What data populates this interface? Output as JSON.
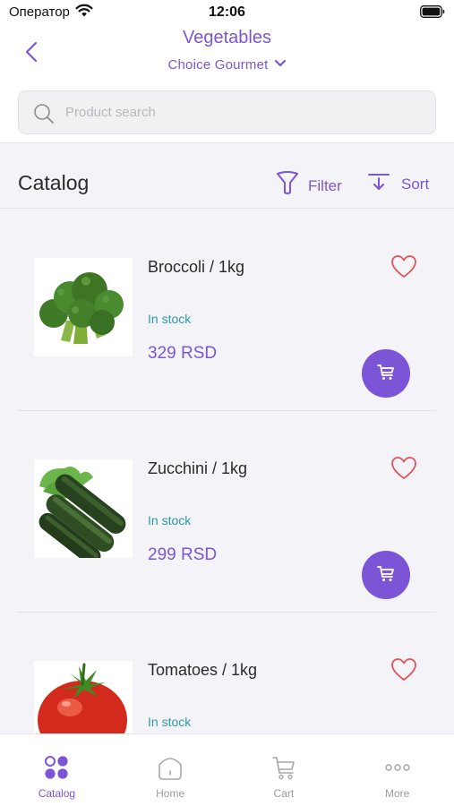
{
  "status_bar": {
    "carrier": "Оператор",
    "time": "12:06",
    "icons": [
      "wifi-icon",
      "battery-icon"
    ]
  },
  "header": {
    "title": "Vegetables",
    "store": "Choice Gourmet",
    "back_icon": "chevron-left-icon",
    "store_icon": "chevron-down-icon"
  },
  "search": {
    "placeholder": "Product search",
    "value": ""
  },
  "catalog_bar": {
    "title": "Catalog",
    "filter_label": "Filter",
    "sort_label": "Sort"
  },
  "products": [
    {
      "name": "Broccoli / 1kg",
      "stock": "In stock",
      "price": "329 RSD",
      "image": "broccoli",
      "favorite": false
    },
    {
      "name": "Zucchini / 1kg",
      "stock": "In stock",
      "price": "299 RSD",
      "image": "zucchini",
      "favorite": false
    },
    {
      "name": "Tomatoes / 1kg",
      "stock": "In stock",
      "price": "",
      "image": "tomato",
      "favorite": false
    }
  ],
  "tabs": [
    {
      "label": "Catalog",
      "icon": "catalog-icon",
      "active": true
    },
    {
      "label": "Home",
      "icon": "home-icon",
      "active": false
    },
    {
      "label": "Cart",
      "icon": "cart-icon",
      "active": false
    },
    {
      "label": "More",
      "icon": "more-icon",
      "active": false
    }
  ],
  "colors": {
    "accent": "#7b55d6",
    "stock": "#2a9aa8",
    "heart": "#e0545c",
    "background": "#f4f3f8"
  }
}
